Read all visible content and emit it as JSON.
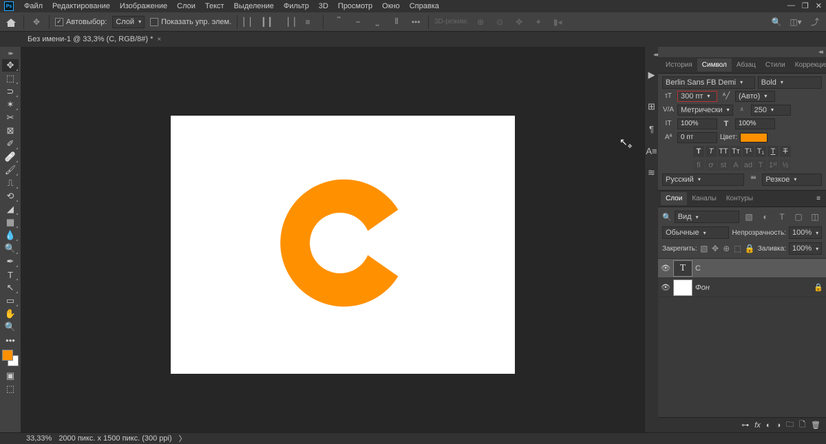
{
  "menubar": [
    "Файл",
    "Редактирование",
    "Изображение",
    "Слои",
    "Текст",
    "Выделение",
    "Фильтр",
    "3D",
    "Просмотр",
    "Окно",
    "Справка"
  ],
  "options": {
    "autoselect_label": "Автовыбор:",
    "autoselect_target": "Слой",
    "show_controls": "Показать упр. элем.",
    "mode3d": "3D-режим:"
  },
  "tab": {
    "title": "Без имени-1 @ 33,3% (C, RGB/8#) *"
  },
  "panels": {
    "top_tabs": [
      "История",
      "Символ",
      "Абзац",
      "Стили",
      "Коррекция"
    ],
    "top_active": 1,
    "character": {
      "font": "Berlin Sans FB Demi",
      "weight": "Bold",
      "size": "300 пт",
      "leading": "(Авто)",
      "kerning": "Метрически",
      "tracking": "250",
      "vscale": "100%",
      "hscale": "100%",
      "baseline": "0 пт",
      "color_label": "Цвет:",
      "color": "#ff9100",
      "language": "Русский",
      "aa": "Резкое"
    },
    "layers_tabs": [
      "Слои",
      "Каналы",
      "Контуры"
    ],
    "layers_active": 0,
    "layers": {
      "filter": "Вид",
      "blend": "Обычные",
      "opacity_label": "Непрозрачность:",
      "opacity": "100%",
      "lock_label": "Закрепить:",
      "fill_label": "Заливка:",
      "fill": "100%",
      "items": [
        {
          "name": "C",
          "type": "text",
          "selected": true
        },
        {
          "name": "Фон",
          "type": "bg",
          "locked": true
        }
      ]
    }
  },
  "status": {
    "zoom": "33,33%",
    "dims": "2000 пикс. x 1500 пикс. (300 ppi)"
  }
}
